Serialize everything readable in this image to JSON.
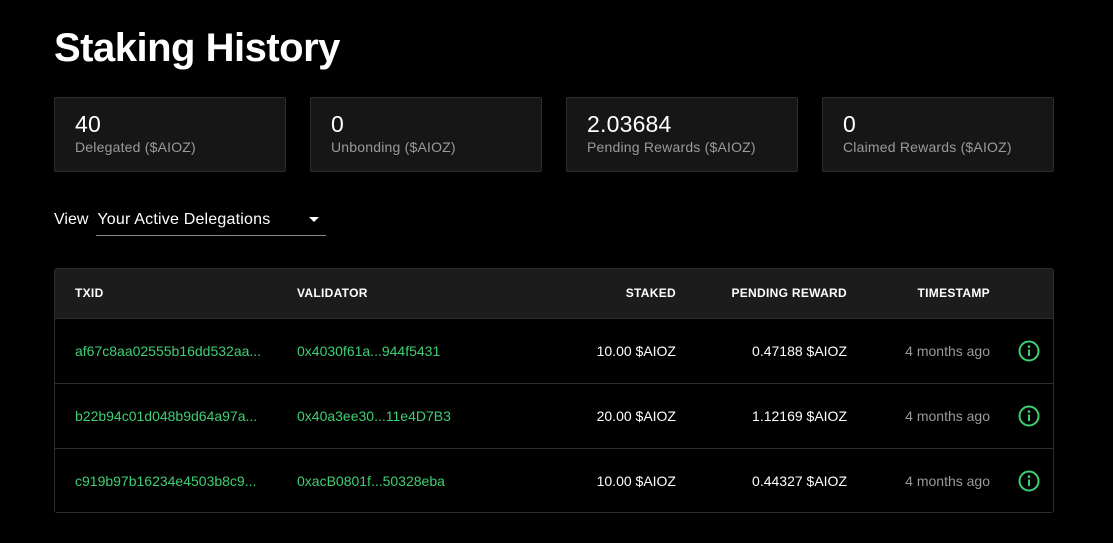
{
  "page": {
    "title": "Staking History"
  },
  "stats": [
    {
      "value": "40",
      "label": "Delegated ($AIOZ)"
    },
    {
      "value": "0",
      "label": "Unbonding ($AIOZ)"
    },
    {
      "value": "2.03684",
      "label": "Pending Rewards ($AIOZ)"
    },
    {
      "value": "0",
      "label": "Claimed Rewards ($AIOZ)"
    }
  ],
  "view": {
    "label": "View",
    "selected": "Your Active Delegations"
  },
  "table": {
    "headers": {
      "txid": "TXID",
      "validator": "VALIDATOR",
      "staked": "STAKED",
      "pending_reward": "PENDING REWARD",
      "timestamp": "TIMESTAMP"
    },
    "rows": [
      {
        "txid": "af67c8aa02555b16dd532aa...",
        "validator": "0x4030f61a...944f5431",
        "staked": "10.00 $AIOZ",
        "pending_reward": "0.47188 $AIOZ",
        "timestamp": "4 months ago"
      },
      {
        "txid": "b22b94c01d048b9d64a97a...",
        "validator": "0x40a3ee30...11e4D7B3",
        "staked": "20.00 $AIOZ",
        "pending_reward": "1.12169 $AIOZ",
        "timestamp": "4 months ago"
      },
      {
        "txid": "c919b97b16234e4503b8c9...",
        "validator": "0xacB0801f...50328eba",
        "staked": "10.00 $AIOZ",
        "pending_reward": "0.44327 $AIOZ",
        "timestamp": "4 months ago"
      }
    ]
  },
  "icons": {
    "info": "info-icon",
    "dropdown": "chevron-down-icon"
  },
  "colors": {
    "background": "#000000",
    "card": "#161616",
    "accent_green": "#3ecf74",
    "muted_text": "#9a9a9a",
    "border": "#2c2c2c"
  }
}
